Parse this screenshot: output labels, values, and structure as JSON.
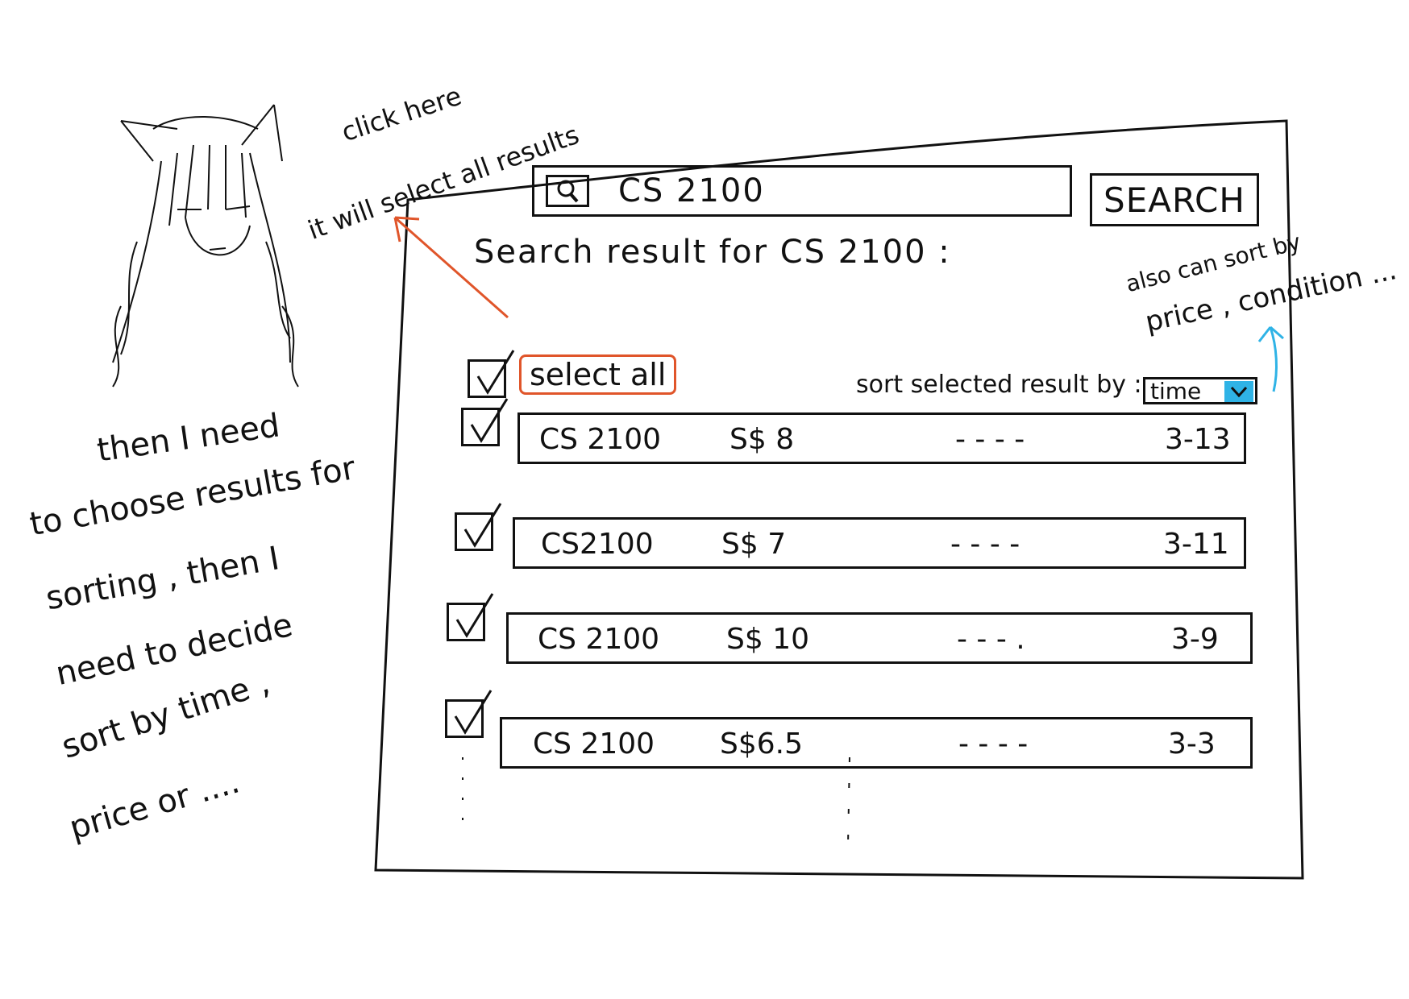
{
  "search": {
    "value": "CS 2100",
    "button_label": "SEARCH"
  },
  "results": {
    "heading": "Search result for CS 2100 :"
  },
  "select_all": {
    "label": "select all",
    "checked": true
  },
  "sort": {
    "label": "sort selected result by :",
    "selected": "time"
  },
  "rows": [
    {
      "code": "CS 2100",
      "price": "S$ 8",
      "filler": "- - - -",
      "date": "3-13",
      "checked": true
    },
    {
      "code": "CS2100",
      "price": "S$ 7",
      "filler": "- - - -",
      "date": "3-11",
      "checked": true
    },
    {
      "code": "CS 2100",
      "price": "S$ 10",
      "filler": "- - - .",
      "date": "3-9",
      "checked": true
    },
    {
      "code": "CS 2100",
      "price": "S$6.5",
      "filler": "- - - -",
      "date": "3-3",
      "checked": true
    }
  ],
  "annotations": {
    "select_all_note_line1": "click here",
    "select_all_note_line2": "it will select all results",
    "sort_note_line1": "also can sort by",
    "sort_note_line2": "price , condition ...",
    "left_note": [
      "then I need",
      "to choose results for",
      "sorting , then I",
      "need to decide",
      "sort by time ,",
      "price or ...."
    ]
  },
  "colors": {
    "highlight_orange": "#e0552a",
    "accent_blue": "#2fb3e6",
    "ink": "#111111"
  },
  "icons": {
    "search": "magnifier-icon",
    "dropdown": "chevron-down-icon",
    "check": "check-icon"
  }
}
